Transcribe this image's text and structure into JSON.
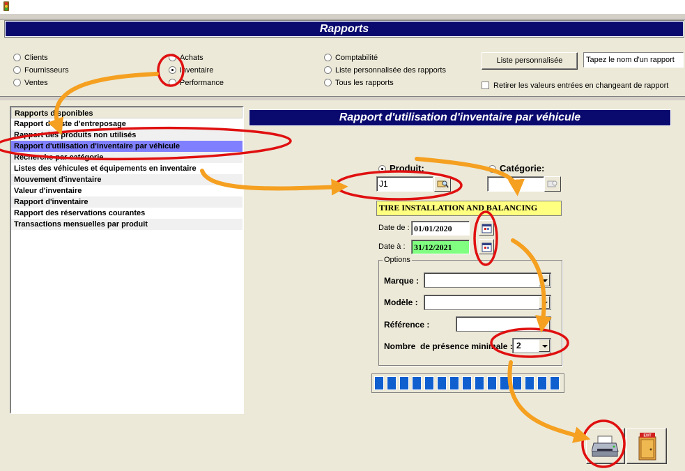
{
  "header": {
    "title": "Rapports"
  },
  "report_types": {
    "col1": [
      "Clients",
      "Fournisseurs",
      "Ventes"
    ],
    "col2": [
      "Achats",
      "Inventaire",
      "Performance"
    ],
    "col3": [
      "Comptabilité",
      "Liste personnalisée des rapports",
      "Tous les rapports"
    ],
    "selected": "Inventaire"
  },
  "custom_list_button": "Liste personnalisée",
  "report_name_input": {
    "value": "Tapez le nom d'un rapport"
  },
  "retirer_checkbox": {
    "label": "Retirer les valeurs entrées en changeant de rapport",
    "checked": false
  },
  "report_list": {
    "header": "Rapports disponibles",
    "items": [
      "Rapport de liste d'entreposage",
      "Rapport des produits non utilisés",
      "Rapport d'utilisation d'inventaire par véhicule",
      "Recherche par catégorie",
      "Listes des véhicules et équipements en inventaire",
      "Mouvement d'inventaire",
      "Valeur d'inventaire",
      "Rapport d'inventaire",
      "Rapport des réservations courantes",
      "Transactions mensuelles par produit"
    ],
    "selected_index": 2
  },
  "report_title": "Rapport d'utilisation d'inventaire par véhicule",
  "filters": {
    "produit_label": "Produit:",
    "categorie_label": "Catégorie:",
    "produit_value": "J1",
    "categorie_value": "",
    "product_description": "TIRE INSTALLATION AND BALANCING",
    "date_de_label": "Date de :",
    "date_de_value": "01/01/2020",
    "date_a_label": "Date à :",
    "date_a_value": "31/12/2021"
  },
  "options": {
    "legend": "Options",
    "marque_label": "Marque :",
    "marque_value": "",
    "modele_label": "Modèle :",
    "modele_value": "",
    "reference_label": "Référence :",
    "reference_value": "",
    "presence_label": "Nombre  de présence minimale :",
    "presence_value": "2"
  },
  "progress": {
    "fraction": 1.0,
    "segments": 15
  },
  "exit_sign": "EXIT",
  "colors": {
    "header_bg": "#0a0a6e",
    "selection": "#8080ff",
    "highlight_field": "#ffff80",
    "date_highlight": "#80ff80",
    "annotation_red": "#e01010",
    "annotation_orange": "#f5a020"
  }
}
